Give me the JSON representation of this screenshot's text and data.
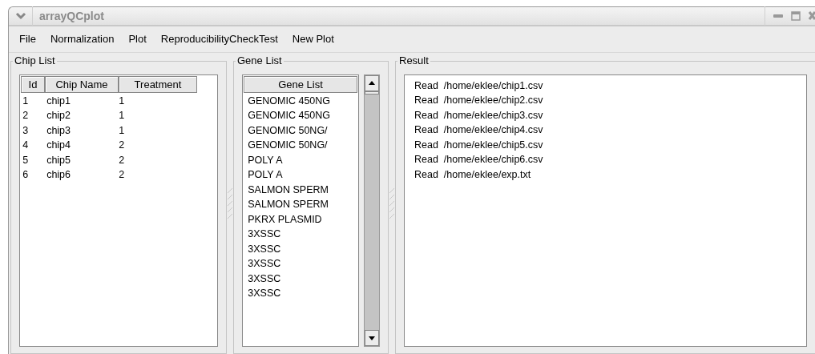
{
  "window": {
    "title": "arrayQCplot"
  },
  "menu": [
    "File",
    "Normalization",
    "Plot",
    "ReproducibilityCheckTest",
    "New Plot"
  ],
  "chip_list": {
    "title": "Chip List",
    "columns": [
      "Id",
      "Chip Name",
      "Treatment"
    ],
    "rows": [
      [
        "1",
        "chip1",
        "1"
      ],
      [
        "2",
        "chip2",
        "1"
      ],
      [
        "3",
        "chip3",
        "1"
      ],
      [
        "4",
        "chip4",
        "2"
      ],
      [
        "5",
        "chip5",
        "2"
      ],
      [
        "6",
        "chip6",
        "2"
      ]
    ]
  },
  "gene_list": {
    "title": "Gene List",
    "column": "Gene List",
    "items": [
      "GENOMIC 450NG",
      "GENOMIC 450NG",
      "GENOMIC 50NG/",
      "GENOMIC 50NG/",
      "POLY A",
      "POLY A",
      "SALMON SPERM",
      "SALMON SPERM",
      "PKRX PLASMID",
      "3XSSC",
      "3XSSC",
      "3XSSC",
      "3XSSC",
      "3XSSC"
    ]
  },
  "result": {
    "title": "Result",
    "lines": [
      "Read  /home/eklee/chip1.csv",
      "Read  /home/eklee/chip2.csv",
      "Read  /home/eklee/chip3.csv",
      "Read  /home/eklee/chip4.csv",
      "Read  /home/eklee/chip5.csv",
      "Read  /home/eklee/chip6.csv",
      "Read  /home/eklee/exp.txt"
    ]
  }
}
